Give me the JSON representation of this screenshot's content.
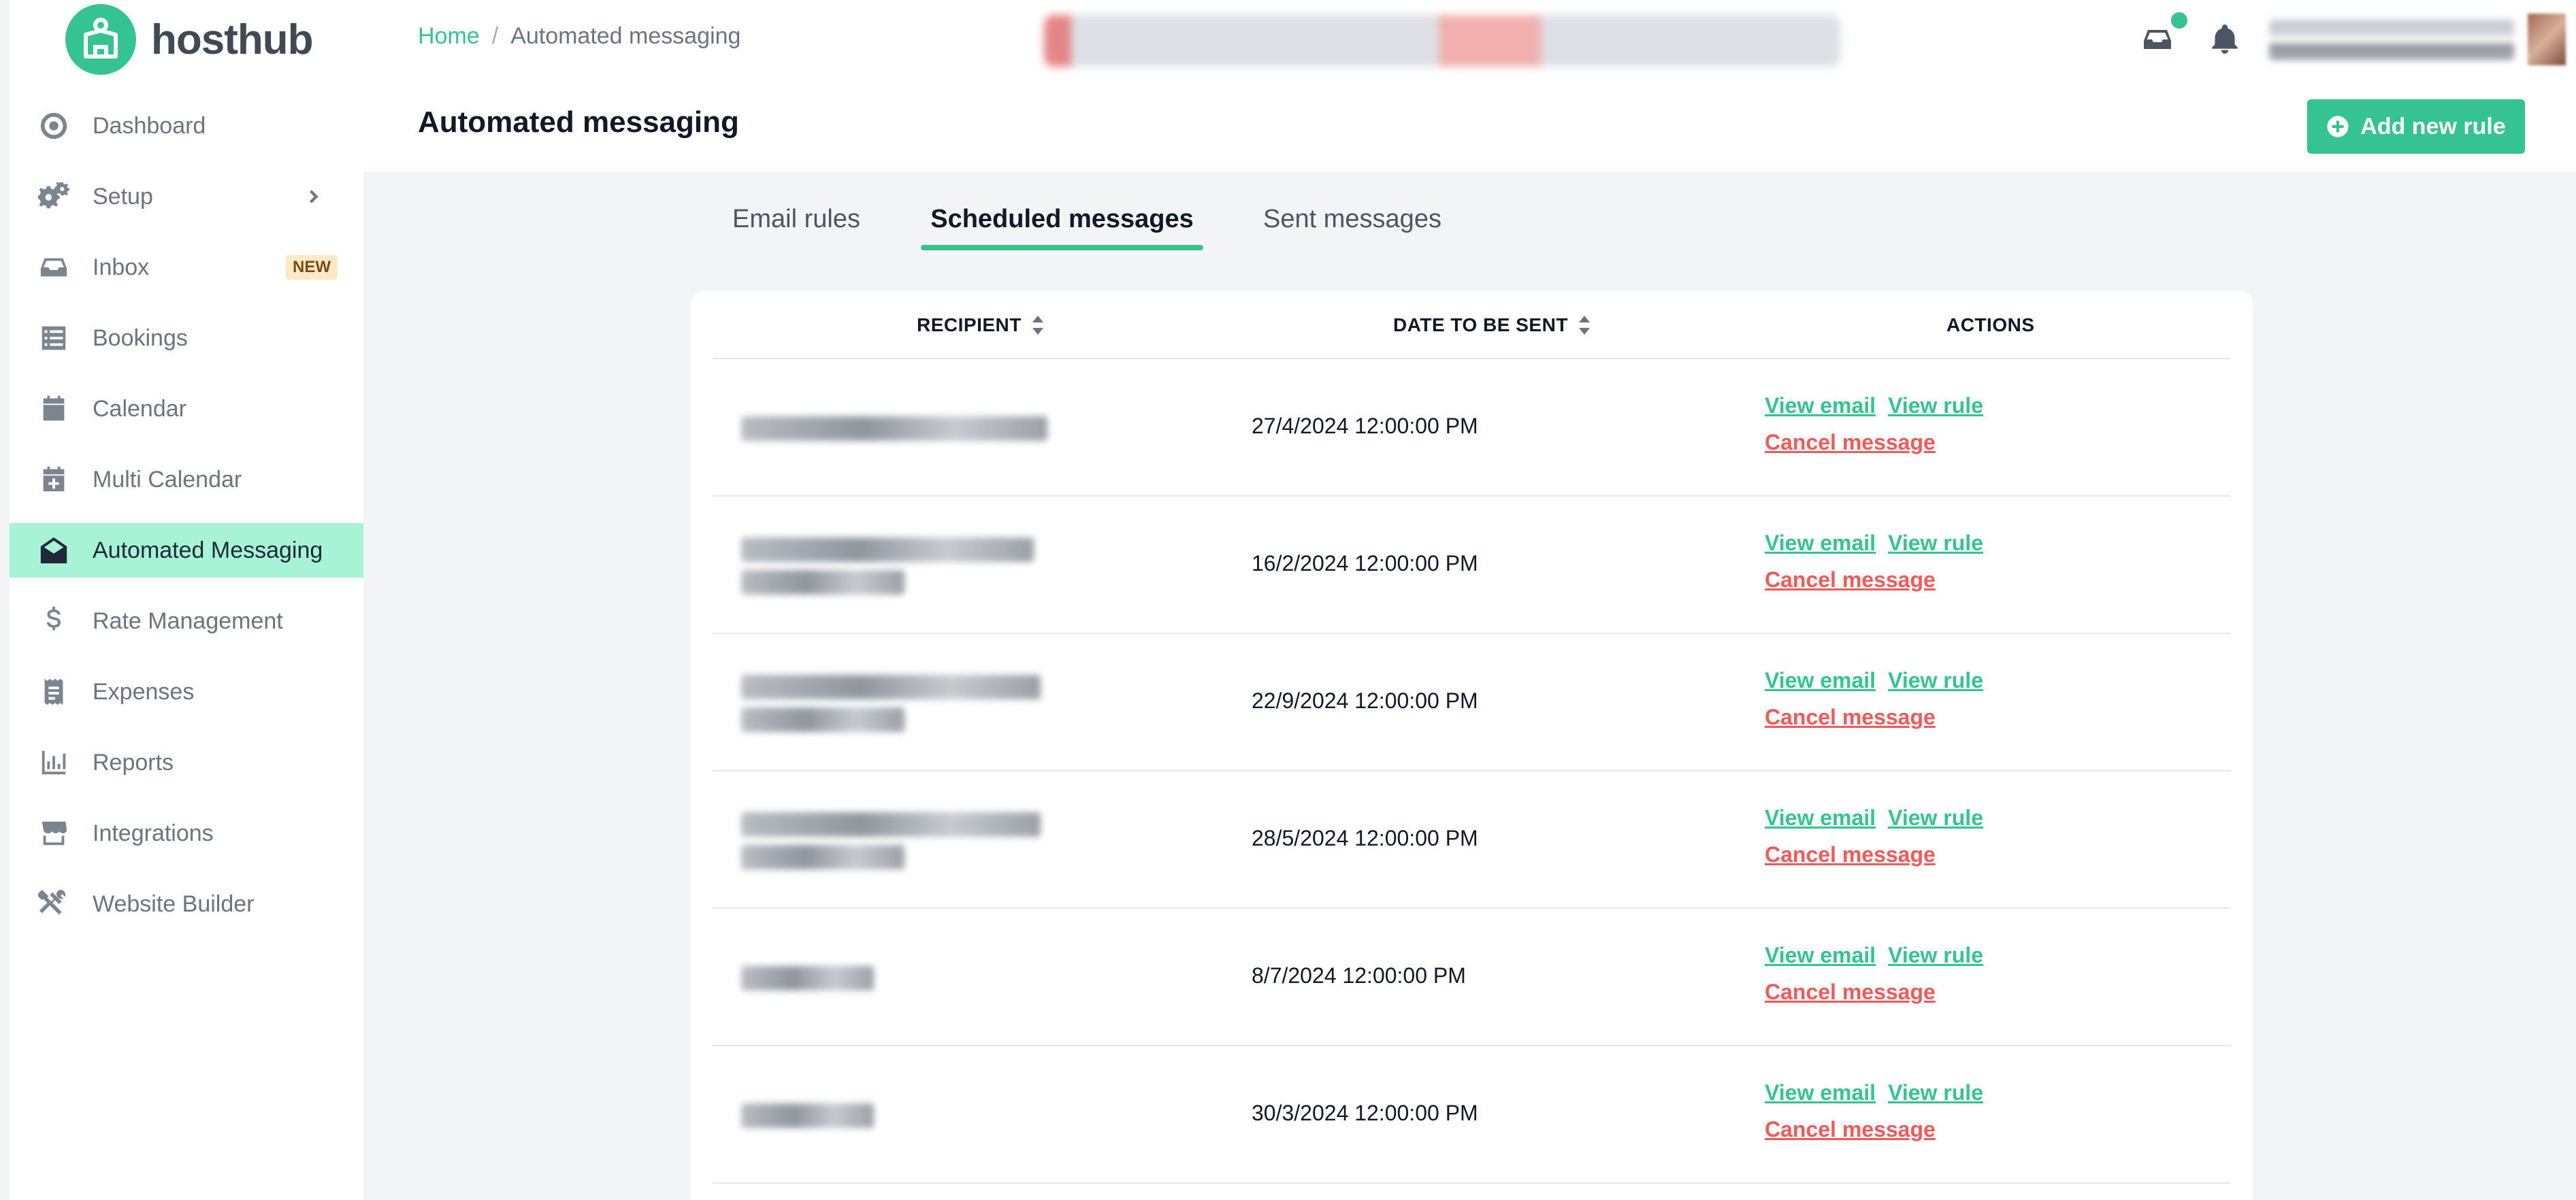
{
  "brand": {
    "name": "hosthub",
    "accent": "#34c391"
  },
  "sidebar": {
    "items": [
      {
        "id": "dashboard",
        "label": "Dashboard",
        "icon": "dashboard-icon"
      },
      {
        "id": "setup",
        "label": "Setup",
        "icon": "gears-icon",
        "has_chevron": true
      },
      {
        "id": "inbox",
        "label": "Inbox",
        "icon": "inbox-icon",
        "badge": "NEW"
      },
      {
        "id": "bookings",
        "label": "Bookings",
        "icon": "list-icon"
      },
      {
        "id": "calendar",
        "label": "Calendar",
        "icon": "calendar-icon"
      },
      {
        "id": "multi-calendar",
        "label": "Multi Calendar",
        "icon": "calendar-plus-icon"
      },
      {
        "id": "automated-messaging",
        "label": "Automated Messaging",
        "icon": "envelope-open-icon",
        "active": true
      },
      {
        "id": "rate-management",
        "label": "Rate Management",
        "icon": "dollar-icon"
      },
      {
        "id": "expenses",
        "label": "Expenses",
        "icon": "receipt-icon"
      },
      {
        "id": "reports",
        "label": "Reports",
        "icon": "bar-chart-icon"
      },
      {
        "id": "integrations",
        "label": "Integrations",
        "icon": "store-icon"
      },
      {
        "id": "website-builder",
        "label": "Website Builder",
        "icon": "tools-icon"
      }
    ]
  },
  "header": {
    "breadcrumb": {
      "home": "Home",
      "separator": "/",
      "current": "Automated messaging"
    },
    "title": "Automated messaging",
    "add_button": "Add new rule"
  },
  "tabs": [
    {
      "label": "Email rules",
      "active": false
    },
    {
      "label": "Scheduled messages",
      "active": true
    },
    {
      "label": "Sent messages",
      "active": false
    }
  ],
  "table": {
    "columns": {
      "recipient": "RECIPIENT",
      "date": "DATE TO BE SENT",
      "actions": "ACTIONS"
    },
    "action_labels": {
      "view_email": "View email",
      "view_rule": "View rule",
      "cancel": "Cancel message"
    },
    "rows": [
      {
        "date": "27/4/2024 12:00:00 PM"
      },
      {
        "date": "16/2/2024 12:00:00 PM"
      },
      {
        "date": "22/9/2024 12:00:00 PM"
      },
      {
        "date": "28/5/2024 12:00:00 PM"
      },
      {
        "date": "8/7/2024 12:00:00 PM"
      },
      {
        "date": "30/3/2024 12:00:00 PM"
      }
    ]
  }
}
